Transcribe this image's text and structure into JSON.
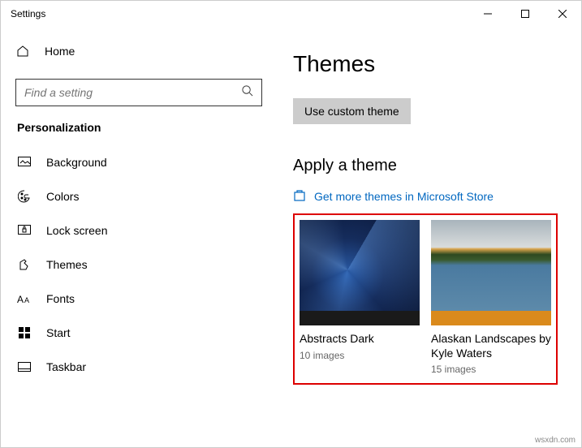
{
  "window": {
    "title": "Settings"
  },
  "sidebar": {
    "home_label": "Home",
    "search_placeholder": "Find a setting",
    "category": "Personalization",
    "items": [
      {
        "label": "Background"
      },
      {
        "label": "Colors"
      },
      {
        "label": "Lock screen"
      },
      {
        "label": "Themes"
      },
      {
        "label": "Fonts"
      },
      {
        "label": "Start"
      },
      {
        "label": "Taskbar"
      }
    ]
  },
  "main": {
    "title": "Themes",
    "custom_button": "Use custom theme",
    "apply_title": "Apply a theme",
    "store_link": "Get more themes in Microsoft Store",
    "themes": [
      {
        "name": "Abstracts Dark",
        "count": "10 images"
      },
      {
        "name": "Alaskan Landscapes by Kyle Waters",
        "count": "15 images"
      }
    ]
  },
  "watermark": "wsxdn.com"
}
